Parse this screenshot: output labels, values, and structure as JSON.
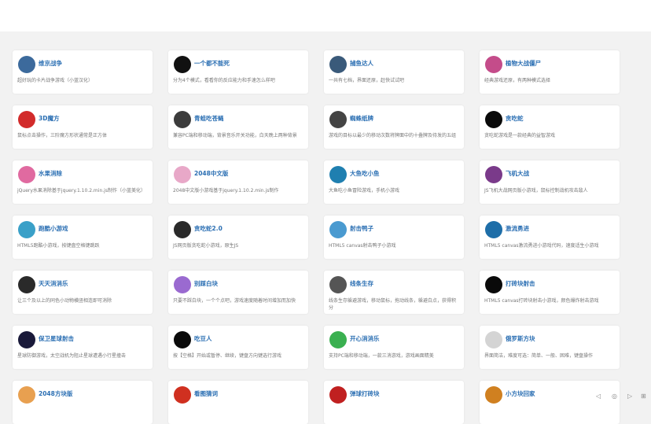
{
  "cards": [
    {
      "title": "维京战争",
      "desc": "超好玩的卡片战争游戏（小蓝汉化）",
      "icon": "viking-icon",
      "color": "#3c6a9c"
    },
    {
      "title": "一个都不能死",
      "desc": "分为4个模式，看看你的反应能力和手速怎么样吧",
      "icon": "runner-icon",
      "color": "#111111"
    },
    {
      "title": "捕鱼达人",
      "desc": "一共有七档，界面还原，赶快试试吧",
      "icon": "fish-catcher-icon",
      "color": "#3a5a7a"
    },
    {
      "title": "植物大战僵尸",
      "desc": "经典游戏还原，有两种模式选择",
      "icon": "plants-zombies-icon",
      "color": "#c44c8a"
    },
    {
      "title": "3D魔方",
      "desc": "鼠标点击操作，三阶魔方形状通常是正方体",
      "icon": "rubiks-cube-icon",
      "color": "#d22b2b"
    },
    {
      "title": "青蛙吃苍蝇",
      "desc": "兼容PC端和移动端，背景音乐开关功能，白天晚上两种背景",
      "icon": "frog-icon",
      "color": "#3c3c3c"
    },
    {
      "title": "蜘蛛纸牌",
      "desc": "游戏的目标以最少的移动次数将牌面中的十叠牌及待发的五组",
      "icon": "spider-card-icon",
      "color": "#444444"
    },
    {
      "title": "贪吃蛇",
      "desc": "贪吃蛇游戏是一款经典的益智游戏",
      "icon": "snake-icon",
      "color": "#0a0a0a"
    },
    {
      "title": "水果消除",
      "desc": "jQuery水果消除基于jquery.1.10.2.min.js制作（小蓝美化）",
      "icon": "fruit-icon",
      "color": "#e06aa0"
    },
    {
      "title": "2048中文版",
      "desc": "2048中文版小游戏基于jquery.1.10.2.min.js制作",
      "icon": "tile-2048-icon",
      "color": "#e8a8c8"
    },
    {
      "title": "大鱼吃小鱼",
      "desc": "大鱼吃小鱼冒险游戏，手机小游戏",
      "icon": "big-fish-icon",
      "color": "#1f7fb0"
    },
    {
      "title": "飞机大战",
      "desc": "JS飞机大战网页版小游戏，鼠标控制战机攻击敌人",
      "icon": "plane-icon",
      "color": "#7a3a8a"
    },
    {
      "title": "跑酷小游戏",
      "desc": "HTML5跑酷小游戏，按键盘空格键跳跃",
      "icon": "parkour-icon",
      "color": "#3aa0c8"
    },
    {
      "title": "贪吃蛇2.0",
      "desc": "JS网页版贪吃蛇小游戏，原生JS",
      "icon": "snake2-icon",
      "color": "#2a2a2a"
    },
    {
      "title": "射击鸭子",
      "desc": "HTML5 canvas射击鸭子小游戏",
      "icon": "duck-icon",
      "color": "#4a9ad0"
    },
    {
      "title": "激流勇进",
      "desc": "HTML5 canvas激流勇进小游戏代码，速度适生小游戏",
      "icon": "rapids-icon",
      "color": "#1e6ea8"
    },
    {
      "title": "天天消消乐",
      "desc": "让三个及以上的同色小动物横竖相连即可消除",
      "icon": "match-three-icon",
      "color": "#2a2a2a"
    },
    {
      "title": "别踩白块",
      "desc": "只要不踩白块，一个个点吧，游戏速度随着时间增加而加快",
      "icon": "white-tile-icon",
      "color": "#9a6ad0"
    },
    {
      "title": "线条生存",
      "desc": "线条生存躲避游戏，移动鼠标，拖动线条，躲避白点，获得积分",
      "icon": "line-survive-icon",
      "color": "#555555"
    },
    {
      "title": "打砖块射击",
      "desc": "HTML5 canvas打砖块射击小游戏，颜色爆炸射击游戏",
      "icon": "brick-shoot-icon",
      "color": "#0a0a0a"
    },
    {
      "title": "保卫星球射击",
      "desc": "星球防御游戏，太空战机为阻止星球遭遇小行星撞击",
      "icon": "planet-defense-icon",
      "color": "#1a1a3a"
    },
    {
      "title": "吃豆人",
      "desc": "按【空格】开始或暂停、继续，键盘方向键选行游戏",
      "icon": "pacman-icon",
      "color": "#0a0a0a"
    },
    {
      "title": "开心消消乐",
      "desc": "支持PC端和移动端，一款三消游戏，游戏画面精美",
      "icon": "happy-match-icon",
      "color": "#3ab050"
    },
    {
      "title": "俄罗斯方块",
      "desc": "界面简洁，难度可选：简单、一般、困难，键盘操作",
      "icon": "tetris-icon",
      "color": "#d4d4d4"
    },
    {
      "title": "2048方块版",
      "desc": "",
      "icon": "block-2048-icon",
      "color": "#e8a050"
    },
    {
      "title": "看图猜词",
      "desc": "",
      "icon": "guess-word-icon",
      "color": "#d03020"
    },
    {
      "title": "弹球打砖块",
      "desc": "",
      "icon": "ball-brick-icon",
      "color": "#c02020"
    },
    {
      "title": "小方块回家",
      "desc": "",
      "icon": "block-home-icon",
      "color": "#d08020"
    }
  ],
  "bottom_controls": [
    "◁",
    "◎",
    "▷",
    "⊞"
  ]
}
